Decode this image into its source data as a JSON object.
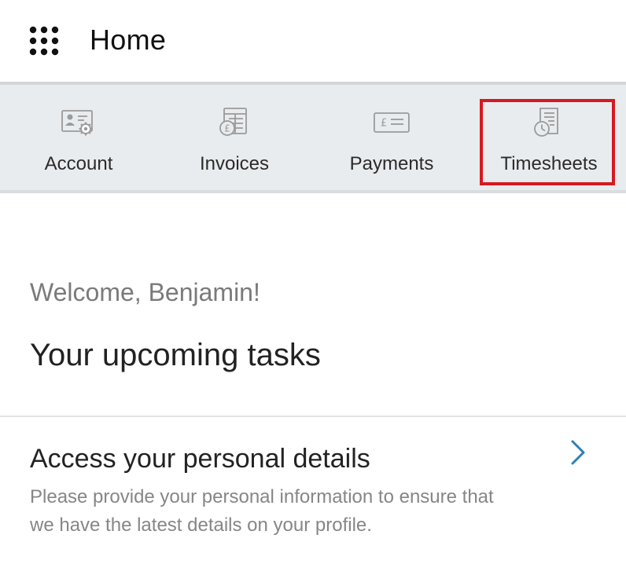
{
  "header": {
    "title": "Home",
    "menu_icon": "grid-menu-icon"
  },
  "nav": {
    "items": [
      {
        "label": "Account",
        "icon": "account-settings-icon"
      },
      {
        "label": "Invoices",
        "icon": "invoice-pound-icon"
      },
      {
        "label": "Payments",
        "icon": "payment-card-icon"
      },
      {
        "label": "Timesheets",
        "icon": "timesheet-clock-icon"
      }
    ],
    "highlighted": "Timesheets",
    "highlight_color": "#d7191f"
  },
  "welcome": {
    "greeting": "Welcome, Benjamin!",
    "tasks_heading": "Your upcoming tasks"
  },
  "tasks": [
    {
      "title": "Access your personal details",
      "description": "Please provide your personal information to ensure that we have the latest details on your profile.",
      "chevron_color": "#2f7fb0"
    }
  ],
  "colors": {
    "nav_background": "#e9ecef",
    "icon_gray": "#9a9a9a"
  }
}
